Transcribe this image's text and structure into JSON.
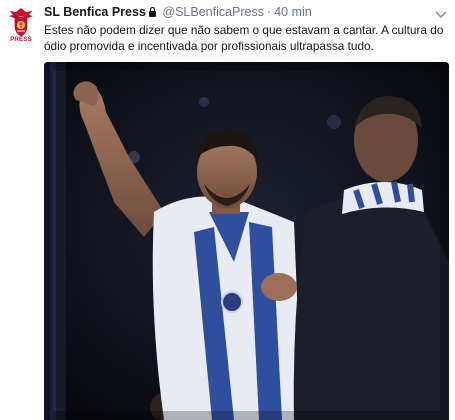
{
  "tweet": {
    "author_name": "SL Benfica Press",
    "handle": "@SLBenficaPress",
    "separator": "·",
    "time": "40 min",
    "text": "Estes não podem dizer que não sabem o que estavam a cantar. A cultura do ódio promovida e incentivada por profissionais ultrapassa tudo.",
    "avatar_label": "PRESS",
    "icons": {
      "verified": "lock-icon",
      "menu": "chevron-down-icon",
      "avatar": "benfica-crest-icon"
    },
    "media": {
      "type": "video-still",
      "description_colors": {
        "background": "#0c0e16",
        "shirt_blue": "#2f4f9e",
        "shirt_white": "#e8ecf2"
      }
    }
  },
  "colors": {
    "name": "#14171a",
    "muted": "#657786",
    "brand_red": "#c8102e"
  }
}
